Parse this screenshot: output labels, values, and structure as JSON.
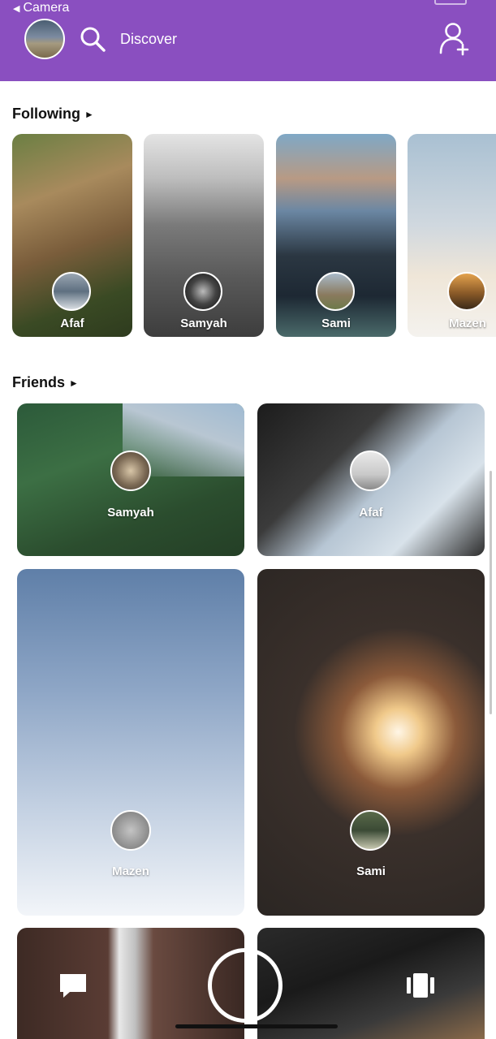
{
  "colors": {
    "accent": "#8a4fc0"
  },
  "status_bar": {
    "back_label": "Camera",
    "back_icon": "back-triangle-icon"
  },
  "header": {
    "avatar_icon": "profile-avatar",
    "search_icon": "search-icon",
    "search_label": "Discover",
    "add_friend_icon": "add-user-icon"
  },
  "following": {
    "title": "Following",
    "items": [
      {
        "name": "Afaf"
      },
      {
        "name": "Samyah"
      },
      {
        "name": "Sami"
      },
      {
        "name": "Mazen"
      }
    ]
  },
  "friends": {
    "title": "Friends",
    "items": [
      {
        "name": "Samyah"
      },
      {
        "name": "Afaf"
      },
      {
        "name": "Mazen"
      },
      {
        "name": "Sami"
      },
      {
        "name": ""
      },
      {
        "name": ""
      }
    ]
  },
  "bottom_bar": {
    "chat_icon": "chat-icon",
    "capture_icon": "capture-button",
    "stories_icon": "stories-icon"
  }
}
